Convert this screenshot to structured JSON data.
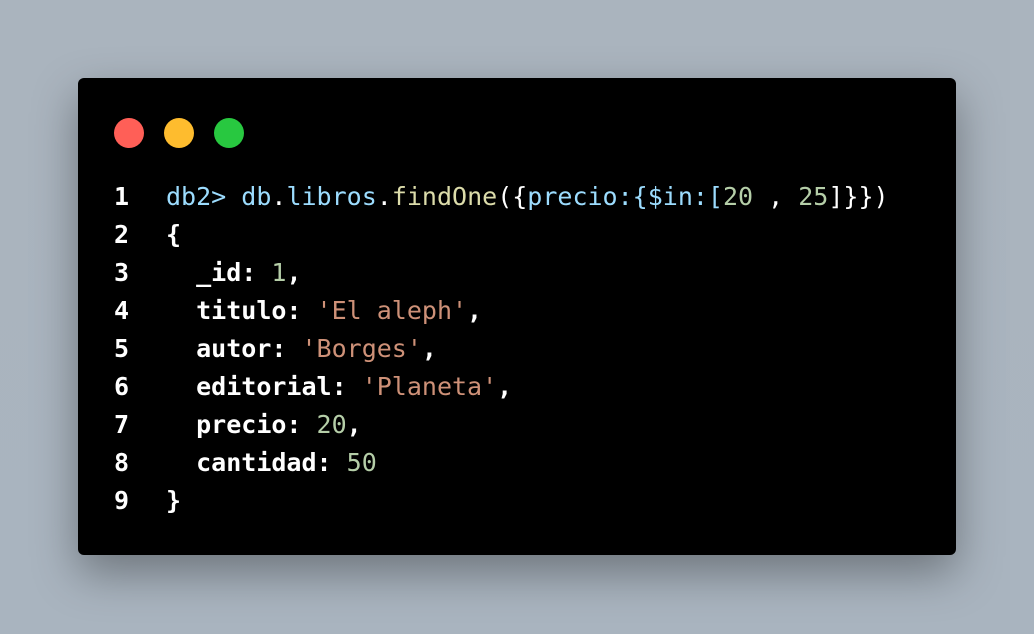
{
  "window": {
    "controls": [
      {
        "name": "close",
        "color": "#ff5f57"
      },
      {
        "name": "minimize",
        "color": "#febc2e"
      },
      {
        "name": "maximize",
        "color": "#28c840"
      }
    ]
  },
  "code": {
    "line_numbers": [
      "1",
      "2",
      "3",
      "4",
      "5",
      "6",
      "7",
      "8",
      "9"
    ],
    "line1": {
      "prompt": "db2>",
      "db": "db",
      "dot1": ".",
      "collection": "libros",
      "dot2": ".",
      "method": "findOne",
      "open": "({",
      "field": "precio",
      "colon1": ":{",
      "operator": "$in",
      "colon2": ":[",
      "val1": "20",
      "sep": " , ",
      "val2": "25",
      "close": "]}})"
    },
    "line2": "{",
    "line3": {
      "key": "_id",
      "value": "1",
      "trail": ","
    },
    "line4": {
      "key": "titulo",
      "value": "'El aleph'",
      "trail": ","
    },
    "line5": {
      "key": "autor",
      "value": "'Borges'",
      "trail": ","
    },
    "line6": {
      "key": "editorial",
      "value": "'Planeta'",
      "trail": ","
    },
    "line7": {
      "key": "precio",
      "value": "20",
      "trail": ","
    },
    "line8": {
      "key": "cantidad",
      "value": "50",
      "trail": ""
    },
    "line9": "}"
  }
}
